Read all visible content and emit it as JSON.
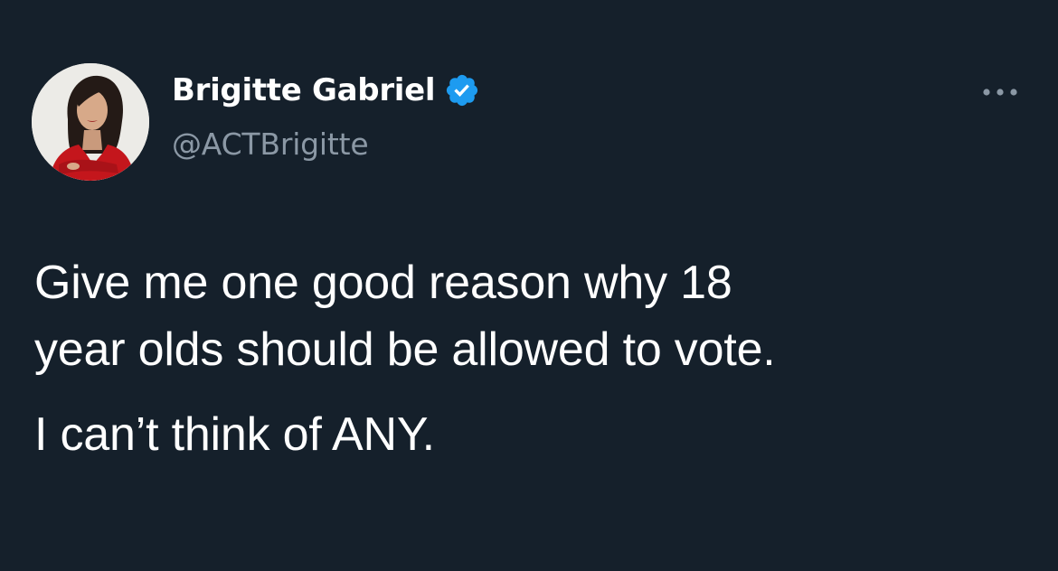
{
  "tweet": {
    "author": {
      "display_name": "Brigitte Gabriel",
      "handle": "@ACTBrigitte",
      "verified": true,
      "avatar_icon": "profile-photo"
    },
    "more_icon": "more-horizontal-icon",
    "text_lines": [
      "Give me one good reason why 18",
      "year olds should be allowed to vote."
    ],
    "text_second_paragraph": "I can’t think of ANY."
  },
  "colors": {
    "background": "#15202b",
    "primary_text": "#ffffff",
    "secondary_text": "#8b98a5",
    "verified_blue": "#1d9bf0"
  }
}
